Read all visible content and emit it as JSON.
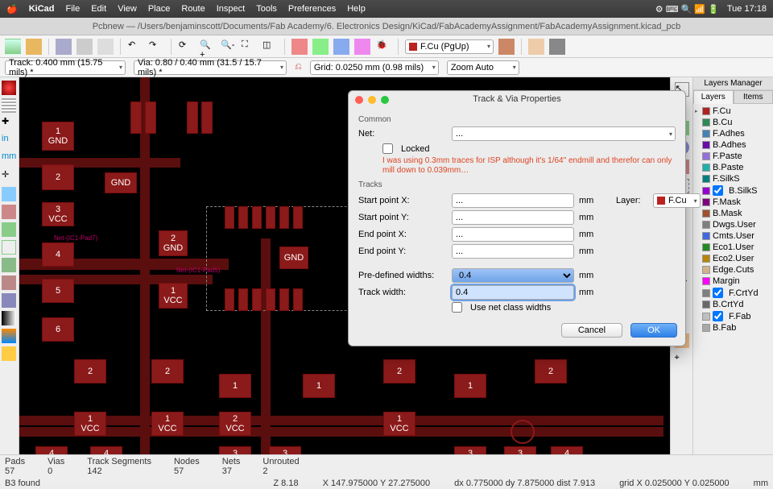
{
  "menubar": {
    "app": "KiCad",
    "items": [
      "File",
      "Edit",
      "View",
      "Place",
      "Route",
      "Inspect",
      "Tools",
      "Preferences",
      "Help"
    ],
    "clock": "Tue 17:18"
  },
  "titlebar": "Pcbnew — /Users/benjaminscott/Documents/Fab Academy/6. Electronics Design/KiCad/FabAcademyAssignment/FabAcademyAssignment.kicad_pcb",
  "options": {
    "track": "Track: 0.400 mm (15.75 mils) *",
    "via": "Via: 0.80 / 0.40 mm (31.5 / 15.7 mils) *",
    "grid": "Grid: 0.0250 mm (0.98 mils)",
    "zoom": "Zoom Auto",
    "toolbar_layer": "F.Cu (PgUp)"
  },
  "layers_panel": {
    "title": "Layers Manager",
    "tabs": [
      "Layers",
      "Items"
    ],
    "active_tab": "Layers",
    "items": [
      {
        "name": "F.Cu",
        "color": "#b22222",
        "sel": true
      },
      {
        "name": "B.Cu",
        "color": "#2e8b57"
      },
      {
        "name": "F.Adhes",
        "color": "#4682b4"
      },
      {
        "name": "B.Adhes",
        "color": "#6a0dad"
      },
      {
        "name": "F.Paste",
        "color": "#9370db"
      },
      {
        "name": "B.Paste",
        "color": "#20b2aa"
      },
      {
        "name": "F.SilkS",
        "color": "#008080"
      },
      {
        "name": "B.SilkS",
        "color": "#9400d3",
        "chk": true
      },
      {
        "name": "F.Mask",
        "color": "#800080"
      },
      {
        "name": "B.Mask",
        "color": "#a0522d"
      },
      {
        "name": "Dwgs.User",
        "color": "#808080"
      },
      {
        "name": "Cmts.User",
        "color": "#4169e1"
      },
      {
        "name": "Eco1.User",
        "color": "#228b22"
      },
      {
        "name": "Eco2.User",
        "color": "#b8860b"
      },
      {
        "name": "Edge.Cuts",
        "color": "#d2b48c"
      },
      {
        "name": "Margin",
        "color": "#ff00ff"
      },
      {
        "name": "F.CrtYd",
        "color": "#808080",
        "chk": true
      },
      {
        "name": "B.CrtYd",
        "color": "#696969"
      },
      {
        "name": "F.Fab",
        "color": "#c0c0c0",
        "chk": true
      },
      {
        "name": "B.Fab",
        "color": "#a9a9a9"
      }
    ]
  },
  "dialog": {
    "title": "Track & Via Properties",
    "common": "Common",
    "net_label": "Net:",
    "net_value": "...",
    "locked_label": "Locked",
    "note": "I was using 0.3mm traces for ISP although it's 1/64\" endmill and therefor can only mill down to 0.039mm…",
    "tracks_label": "Tracks",
    "start_x_label": "Start point X:",
    "start_x": "...",
    "start_y_label": "Start point Y:",
    "start_y": "...",
    "end_x_label": "End point X:",
    "end_x": "...",
    "end_y_label": "End point Y:",
    "end_y": "...",
    "predef_label": "Pre-defined widths:",
    "predef": "0.4",
    "width_label": "Track width:",
    "width": "0.4",
    "netclass_label": "Use net class widths",
    "layer_label": "Layer:",
    "layer_value": "F.Cu",
    "unit": "mm",
    "cancel": "Cancel",
    "ok": "OK"
  },
  "status": {
    "pads_l": "Pads",
    "pads": "57",
    "vias_l": "Vias",
    "vias": "0",
    "seg_l": "Track Segments",
    "seg": "142",
    "nodes_l": "Nodes",
    "nodes": "57",
    "nets_l": "Nets",
    "nets": "37",
    "unr_l": "Unrouted",
    "unr": "2",
    "found": "B3 found",
    "z": "Z 8.18",
    "xy": "X 147.975000  Y 27.275000",
    "dxy": "dx 0.775000  dy 7.875000  dist 7.913",
    "gridxy": "grid X 0.025000  Y 0.025000",
    "mm": "mm"
  },
  "pcb_labels": {
    "gnd": "GND",
    "vcc": "VCC",
    "n1": "1",
    "n2": "2",
    "n3": "3",
    "n4": "4",
    "n5": "5",
    "n6": "6",
    "net_ic1_7": "Net-(IC1-Pad7)",
    "net_ic1_5": "Net-(IC1-Pad5)"
  },
  "chart_data": null
}
